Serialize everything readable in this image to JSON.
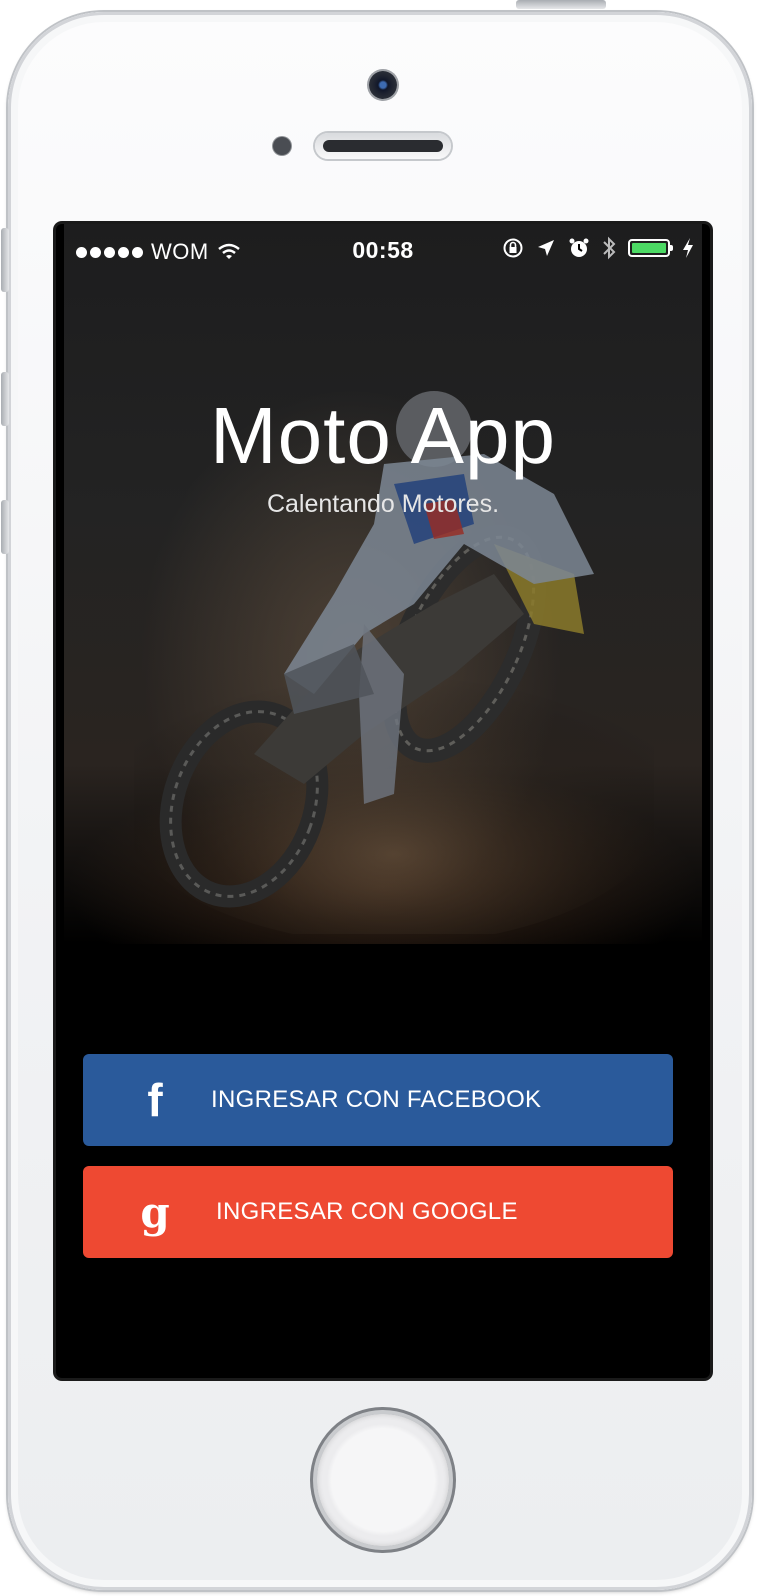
{
  "status_bar": {
    "carrier": "WOM",
    "time": "00:58",
    "battery_level": 1.0,
    "battery_color": "#4cd964",
    "icons": [
      "signal-dots",
      "wifi-icon",
      "rotation-lock-icon",
      "location-arrow-icon",
      "alarm-icon",
      "bluetooth-icon",
      "battery-icon",
      "charging-bolt-icon"
    ]
  },
  "hero": {
    "title": "Moto App",
    "subtitle": "Calentando Motores.",
    "image": "motocross-rider-photo"
  },
  "buttons": {
    "facebook": {
      "icon": "f",
      "icon_name": "facebook-icon",
      "label": "INGRESAR CON FACEBOOK",
      "color": "#2a5a9b"
    },
    "google": {
      "icon": "g",
      "icon_name": "google-icon",
      "label": "INGRESAR CON GOOGLE",
      "color": "#ee4932"
    }
  }
}
